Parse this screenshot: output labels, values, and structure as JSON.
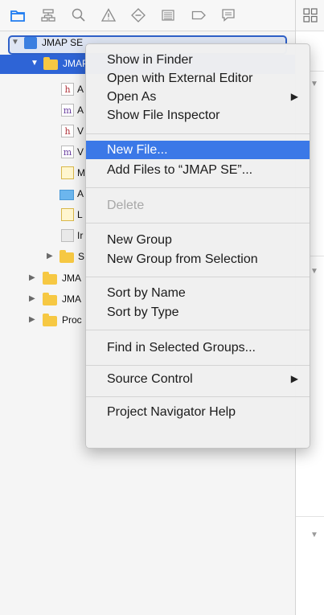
{
  "navigator": {
    "toolbar_icons": [
      "folder-icon",
      "hierarchy-icon",
      "search-icon",
      "warning-icon",
      "test-diamond-icon",
      "list-icon",
      "breakpoint-icon",
      "comment-icon"
    ],
    "root": {
      "label": "JMAP SE"
    },
    "selected_folder": {
      "label": "JMAP"
    },
    "children": [
      {
        "label": "A",
        "type": "h"
      },
      {
        "label": "A",
        "type": "m"
      },
      {
        "label": "V",
        "type": "h"
      },
      {
        "label": "V",
        "type": "m"
      },
      {
        "label": "M",
        "type": "y"
      },
      {
        "label": "A",
        "type": "b"
      },
      {
        "label": "L",
        "type": "y"
      },
      {
        "label": "Ir",
        "type": "g"
      }
    ],
    "subfolder": {
      "label": "S"
    },
    "folders": [
      {
        "label": "JMA"
      },
      {
        "label": "JMA"
      },
      {
        "label": "Proc"
      }
    ]
  },
  "menu": {
    "items": [
      {
        "label": "Show in Finder",
        "state": "normal"
      },
      {
        "label": "Open with External Editor",
        "state": "normal"
      },
      {
        "label": "Open As",
        "state": "submenu"
      },
      {
        "label": "Show File Inspector",
        "state": "normal"
      },
      {
        "label": "New File...",
        "state": "highlighted"
      },
      {
        "label": "Add Files to “JMAP SE”...",
        "state": "normal"
      },
      {
        "label": "Delete",
        "state": "disabled"
      },
      {
        "label": "New Group",
        "state": "normal"
      },
      {
        "label": "New Group from Selection",
        "state": "normal"
      },
      {
        "label": "Sort by Name",
        "state": "normal"
      },
      {
        "label": "Sort by Type",
        "state": "normal"
      },
      {
        "label": "Find in Selected Groups...",
        "state": "normal"
      },
      {
        "label": "Source Control",
        "state": "submenu"
      },
      {
        "label": "Project Navigator Help",
        "state": "normal"
      }
    ],
    "submenu_glyph": "▶"
  },
  "colors": {
    "selection": "#2e64d6",
    "menu_highlight": "#3b78e7",
    "accent": "#1f7cf0"
  }
}
